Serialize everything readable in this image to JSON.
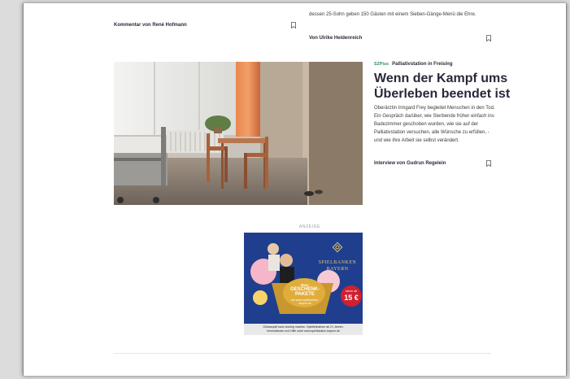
{
  "top_left": {
    "byline": "Kommentar von René Hofmann"
  },
  "top_right": {
    "teaser_end": "dessen 25-Sohn geben 150 Gästen mit einem Sieben-Gänge-Menü die Ehre.",
    "byline": "Von Ulrike Heidenreich"
  },
  "article": {
    "badge": "SZPlus",
    "kicker": "Palliativstation in Freising",
    "headline_line1": "Wenn der Kampf ums",
    "headline_line2": "Überleben beendet ist",
    "teaser": "Oberärztin Irmgard Frey begleitet Menschen in den Tod. Ein Gespräch darüber, wie Sterbende früher einfach ins Badezimmer geschoben wurden, wie sie auf der Palliativstation versuchen, alle Wünsche zu erfüllen, - und wie ihre Arbeit sie selbst verändert.",
    "byline": "Interview von Gudrun Regelein"
  },
  "ad": {
    "label": "ANZEIGE",
    "brand_line1": "SPIELBANKEN",
    "brand_line2": "BAYERN",
    "gift_intro": "Neu:",
    "gift_title": "GESCHENK-PAKETE",
    "gift_sub": "auf www.spielbanken-bayern.de",
    "price_prefix": "schon ab",
    "price": "15 €",
    "footer_line1": "Glücksspiel kann süchtig machen. Spielteilnahme ab 21 Jahren.",
    "footer_line2": "Informationen und Hilfe unter www.spielbanken-bayern.de"
  },
  "colors": {
    "text_dark": "#29293a",
    "sz_plus_green": "#2a8a5c",
    "ad_blue": "#1f3f8e",
    "ad_gold": "#e7c86c",
    "price_red": "#d0202e"
  },
  "icons": {
    "bookmark": "bookmark-icon"
  }
}
